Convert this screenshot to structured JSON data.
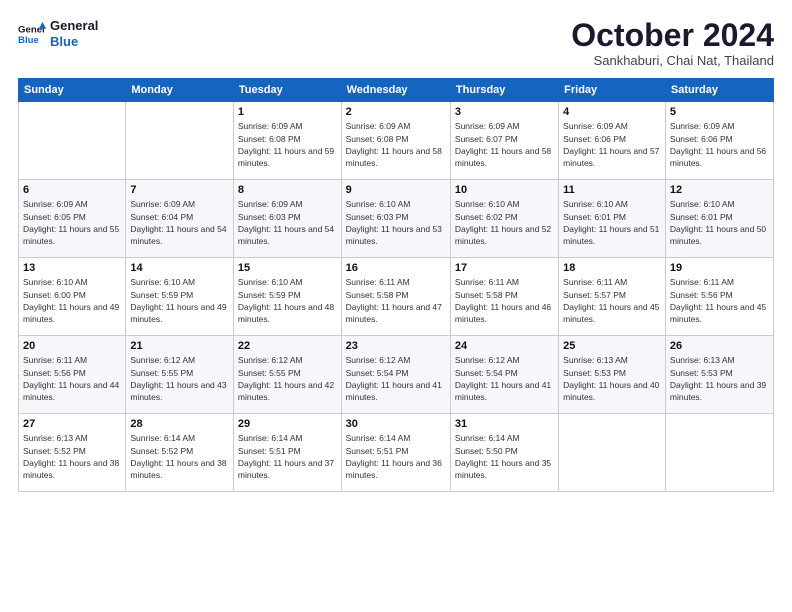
{
  "header": {
    "logo_line1": "General",
    "logo_line2": "Blue",
    "month": "October 2024",
    "location": "Sankhaburi, Chai Nat, Thailand"
  },
  "weekdays": [
    "Sunday",
    "Monday",
    "Tuesday",
    "Wednesday",
    "Thursday",
    "Friday",
    "Saturday"
  ],
  "weeks": [
    [
      {
        "day": "",
        "sunrise": "",
        "sunset": "",
        "daylight": ""
      },
      {
        "day": "",
        "sunrise": "",
        "sunset": "",
        "daylight": ""
      },
      {
        "day": "1",
        "sunrise": "Sunrise: 6:09 AM",
        "sunset": "Sunset: 6:08 PM",
        "daylight": "Daylight: 11 hours and 59 minutes."
      },
      {
        "day": "2",
        "sunrise": "Sunrise: 6:09 AM",
        "sunset": "Sunset: 6:08 PM",
        "daylight": "Daylight: 11 hours and 58 minutes."
      },
      {
        "day": "3",
        "sunrise": "Sunrise: 6:09 AM",
        "sunset": "Sunset: 6:07 PM",
        "daylight": "Daylight: 11 hours and 58 minutes."
      },
      {
        "day": "4",
        "sunrise": "Sunrise: 6:09 AM",
        "sunset": "Sunset: 6:06 PM",
        "daylight": "Daylight: 11 hours and 57 minutes."
      },
      {
        "day": "5",
        "sunrise": "Sunrise: 6:09 AM",
        "sunset": "Sunset: 6:06 PM",
        "daylight": "Daylight: 11 hours and 56 minutes."
      }
    ],
    [
      {
        "day": "6",
        "sunrise": "Sunrise: 6:09 AM",
        "sunset": "Sunset: 6:05 PM",
        "daylight": "Daylight: 11 hours and 55 minutes."
      },
      {
        "day": "7",
        "sunrise": "Sunrise: 6:09 AM",
        "sunset": "Sunset: 6:04 PM",
        "daylight": "Daylight: 11 hours and 54 minutes."
      },
      {
        "day": "8",
        "sunrise": "Sunrise: 6:09 AM",
        "sunset": "Sunset: 6:03 PM",
        "daylight": "Daylight: 11 hours and 54 minutes."
      },
      {
        "day": "9",
        "sunrise": "Sunrise: 6:10 AM",
        "sunset": "Sunset: 6:03 PM",
        "daylight": "Daylight: 11 hours and 53 minutes."
      },
      {
        "day": "10",
        "sunrise": "Sunrise: 6:10 AM",
        "sunset": "Sunset: 6:02 PM",
        "daylight": "Daylight: 11 hours and 52 minutes."
      },
      {
        "day": "11",
        "sunrise": "Sunrise: 6:10 AM",
        "sunset": "Sunset: 6:01 PM",
        "daylight": "Daylight: 11 hours and 51 minutes."
      },
      {
        "day": "12",
        "sunrise": "Sunrise: 6:10 AM",
        "sunset": "Sunset: 6:01 PM",
        "daylight": "Daylight: 11 hours and 50 minutes."
      }
    ],
    [
      {
        "day": "13",
        "sunrise": "Sunrise: 6:10 AM",
        "sunset": "Sunset: 6:00 PM",
        "daylight": "Daylight: 11 hours and 49 minutes."
      },
      {
        "day": "14",
        "sunrise": "Sunrise: 6:10 AM",
        "sunset": "Sunset: 5:59 PM",
        "daylight": "Daylight: 11 hours and 49 minutes."
      },
      {
        "day": "15",
        "sunrise": "Sunrise: 6:10 AM",
        "sunset": "Sunset: 5:59 PM",
        "daylight": "Daylight: 11 hours and 48 minutes."
      },
      {
        "day": "16",
        "sunrise": "Sunrise: 6:11 AM",
        "sunset": "Sunset: 5:58 PM",
        "daylight": "Daylight: 11 hours and 47 minutes."
      },
      {
        "day": "17",
        "sunrise": "Sunrise: 6:11 AM",
        "sunset": "Sunset: 5:58 PM",
        "daylight": "Daylight: 11 hours and 46 minutes."
      },
      {
        "day": "18",
        "sunrise": "Sunrise: 6:11 AM",
        "sunset": "Sunset: 5:57 PM",
        "daylight": "Daylight: 11 hours and 45 minutes."
      },
      {
        "day": "19",
        "sunrise": "Sunrise: 6:11 AM",
        "sunset": "Sunset: 5:56 PM",
        "daylight": "Daylight: 11 hours and 45 minutes."
      }
    ],
    [
      {
        "day": "20",
        "sunrise": "Sunrise: 6:11 AM",
        "sunset": "Sunset: 5:56 PM",
        "daylight": "Daylight: 11 hours and 44 minutes."
      },
      {
        "day": "21",
        "sunrise": "Sunrise: 6:12 AM",
        "sunset": "Sunset: 5:55 PM",
        "daylight": "Daylight: 11 hours and 43 minutes."
      },
      {
        "day": "22",
        "sunrise": "Sunrise: 6:12 AM",
        "sunset": "Sunset: 5:55 PM",
        "daylight": "Daylight: 11 hours and 42 minutes."
      },
      {
        "day": "23",
        "sunrise": "Sunrise: 6:12 AM",
        "sunset": "Sunset: 5:54 PM",
        "daylight": "Daylight: 11 hours and 41 minutes."
      },
      {
        "day": "24",
        "sunrise": "Sunrise: 6:12 AM",
        "sunset": "Sunset: 5:54 PM",
        "daylight": "Daylight: 11 hours and 41 minutes."
      },
      {
        "day": "25",
        "sunrise": "Sunrise: 6:13 AM",
        "sunset": "Sunset: 5:53 PM",
        "daylight": "Daylight: 11 hours and 40 minutes."
      },
      {
        "day": "26",
        "sunrise": "Sunrise: 6:13 AM",
        "sunset": "Sunset: 5:53 PM",
        "daylight": "Daylight: 11 hours and 39 minutes."
      }
    ],
    [
      {
        "day": "27",
        "sunrise": "Sunrise: 6:13 AM",
        "sunset": "Sunset: 5:52 PM",
        "daylight": "Daylight: 11 hours and 38 minutes."
      },
      {
        "day": "28",
        "sunrise": "Sunrise: 6:14 AM",
        "sunset": "Sunset: 5:52 PM",
        "daylight": "Daylight: 11 hours and 38 minutes."
      },
      {
        "day": "29",
        "sunrise": "Sunrise: 6:14 AM",
        "sunset": "Sunset: 5:51 PM",
        "daylight": "Daylight: 11 hours and 37 minutes."
      },
      {
        "day": "30",
        "sunrise": "Sunrise: 6:14 AM",
        "sunset": "Sunset: 5:51 PM",
        "daylight": "Daylight: 11 hours and 36 minutes."
      },
      {
        "day": "31",
        "sunrise": "Sunrise: 6:14 AM",
        "sunset": "Sunset: 5:50 PM",
        "daylight": "Daylight: 11 hours and 35 minutes."
      },
      {
        "day": "",
        "sunrise": "",
        "sunset": "",
        "daylight": ""
      },
      {
        "day": "",
        "sunrise": "",
        "sunset": "",
        "daylight": ""
      }
    ]
  ]
}
